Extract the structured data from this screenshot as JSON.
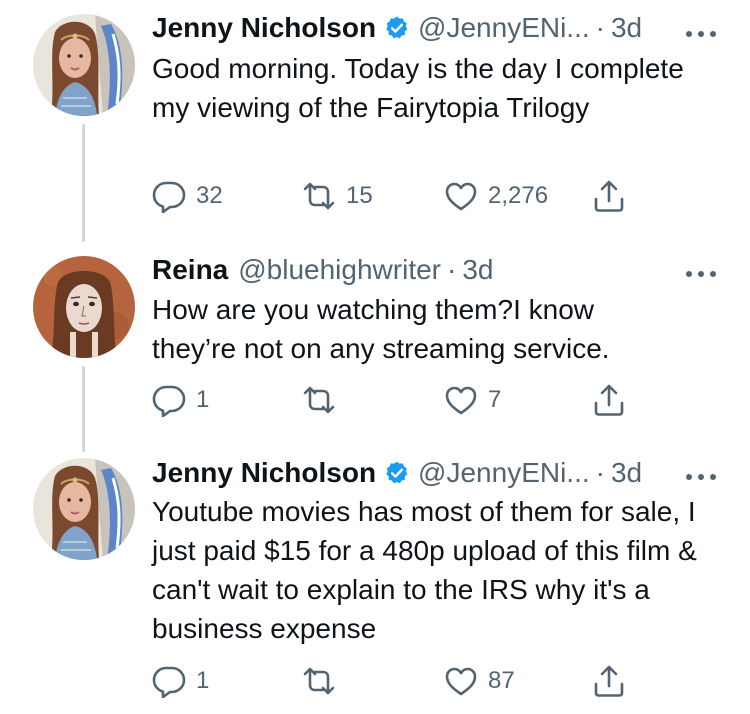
{
  "tweets": [
    {
      "name": "Jenny Nicholson",
      "verified": true,
      "handle": "@JennyENi...",
      "separator": "·",
      "time": "3d",
      "text": "Good morning. Today is the day I complete my viewing of the Fairytopia Trilogy",
      "reply_count": "32",
      "retweet_count": "15",
      "like_count": "2,276"
    },
    {
      "name": "Reina",
      "verified": false,
      "handle": "@bluehighwriter",
      "separator": "·",
      "time": "3d",
      "text": "How are you watching them?I know they’re not on any streaming service.",
      "reply_count": "1",
      "retweet_count": "",
      "like_count": "7"
    },
    {
      "name": "Jenny Nicholson",
      "verified": true,
      "handle": "@JennyENi...",
      "separator": "·",
      "time": "3d",
      "text": "Youtube movies has most of them for sale, I just paid $15 for a 480p upload of this film & can't wait to explain to the IRS why it's a business expense",
      "reply_count": "1",
      "retweet_count": "",
      "like_count": "87"
    }
  ],
  "icons": {
    "verified": "verified-badge-icon",
    "more": "more-dots-icon",
    "reply": "reply-icon",
    "retweet": "retweet-icon",
    "like": "heart-icon",
    "share": "share-icon"
  },
  "colors": {
    "text": "#0f1419",
    "secondary": "#536471",
    "verified_blue": "#1d9bf0",
    "thread_line": "#cfd9de"
  }
}
